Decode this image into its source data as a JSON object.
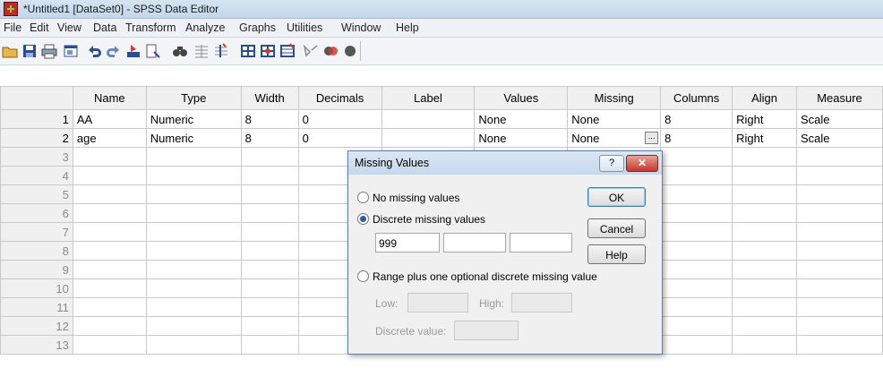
{
  "window": {
    "title": "*Untitled1 [DataSet0] - SPSS Data Editor"
  },
  "menu": [
    "File",
    "Edit",
    "View",
    "Data",
    "Transform",
    "Analyze",
    "Graphs",
    "Utilities",
    "Window",
    "Help"
  ],
  "toolbar_icons": [
    "open-icon",
    "save-icon",
    "print-icon",
    "dialog-recall-icon",
    "undo-icon",
    "redo-icon",
    "goto-case-icon",
    "variables-icon",
    "find-icon",
    "insert-case-icon",
    "insert-variable-icon",
    "split-file-icon",
    "weight-cases-icon",
    "select-cases-icon",
    "value-labels-icon",
    "use-sets-icon",
    "show-all-icon"
  ],
  "grid": {
    "headers": [
      "Name",
      "Type",
      "Width",
      "Decimals",
      "Label",
      "Values",
      "Missing",
      "Columns",
      "Align",
      "Measure"
    ],
    "rows": [
      {
        "n": "1",
        "name": "AA",
        "type": "Numeric",
        "width": "8",
        "decimals": "0",
        "label": "",
        "values": "None",
        "missing": "None",
        "columns": "8",
        "align": "Right",
        "measure": "Scale"
      },
      {
        "n": "2",
        "name": "age",
        "type": "Numeric",
        "width": "8",
        "decimals": "0",
        "label": "",
        "values": "None",
        "missing": "None",
        "columns": "8",
        "align": "Right",
        "measure": "Scale"
      }
    ],
    "empty_rows": [
      "3",
      "4",
      "5",
      "6",
      "7",
      "8",
      "9",
      "10",
      "11",
      "12",
      "13"
    ],
    "ellipsis": "..."
  },
  "dialog": {
    "title": "Missing Values",
    "help_glyph": "?",
    "close_glyph": "✕",
    "no_missing": "No missing values",
    "discrete": "Discrete missing values",
    "discrete_values": [
      "999",
      "",
      ""
    ],
    "range": "Range plus one optional discrete missing value",
    "low_label": "Low:",
    "high_label": "High:",
    "discrete_value_label": "Discrete value:",
    "ok": "OK",
    "cancel": "Cancel",
    "help": "Help"
  }
}
